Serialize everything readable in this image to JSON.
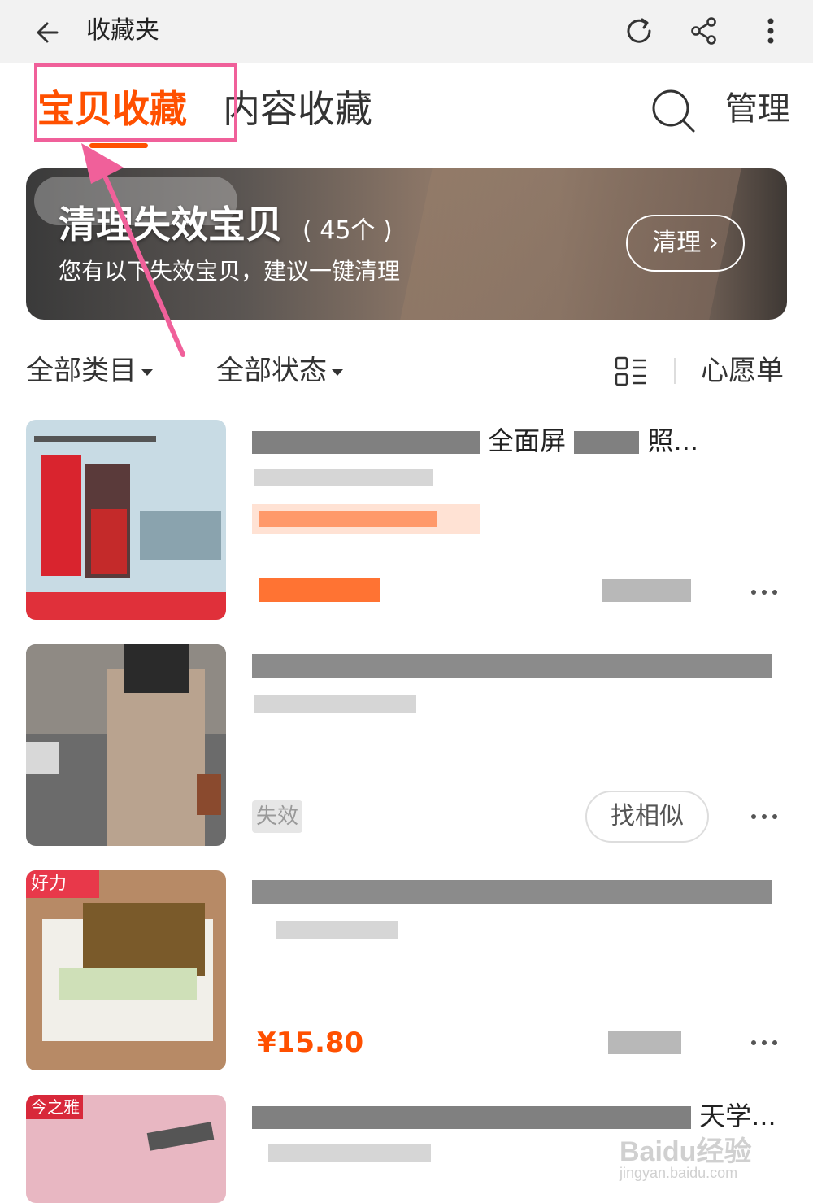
{
  "topbar": {
    "title": "收藏夹",
    "back_icon": "arrow-left-icon",
    "refresh_icon": "refresh-icon",
    "share_icon": "share-icon",
    "more_icon": "more-vertical-icon"
  },
  "tabs": [
    {
      "label": "宝贝收藏",
      "active": true
    },
    {
      "label": "内容收藏",
      "active": false
    }
  ],
  "header_actions": {
    "search_icon": "search-icon",
    "manage_label": "管理"
  },
  "banner": {
    "title": "清理失效宝贝",
    "count": "( 45个 )",
    "subtitle": "您有以下失效宝贝，建议一键清理",
    "button_label": "清理 ›"
  },
  "filters": {
    "category_label": "全部类目",
    "status_label": "全部状态",
    "view_icon": "grid-list-icon",
    "wishlist_label": "心愿单"
  },
  "items": [
    {
      "title_visible": "全面屏",
      "title_suffix": "照...",
      "price": "",
      "status": "",
      "action_label": ""
    },
    {
      "title_visible": "",
      "price": "",
      "status": "失效",
      "action_label": "找相似"
    },
    {
      "title_visible": "",
      "price": "¥15.80",
      "status": "",
      "action_label": ""
    },
    {
      "title_visible": "天学...",
      "price": "",
      "status": "",
      "action_label": "",
      "thumb_badge": "今之雅"
    }
  ],
  "thumb_badges": {
    "item3": "好力"
  },
  "watermark": {
    "logo": "Baidu经验",
    "url": "jingyan.baidu.com"
  },
  "colors": {
    "accent": "#ff5000",
    "annotation": "#f0609a"
  }
}
